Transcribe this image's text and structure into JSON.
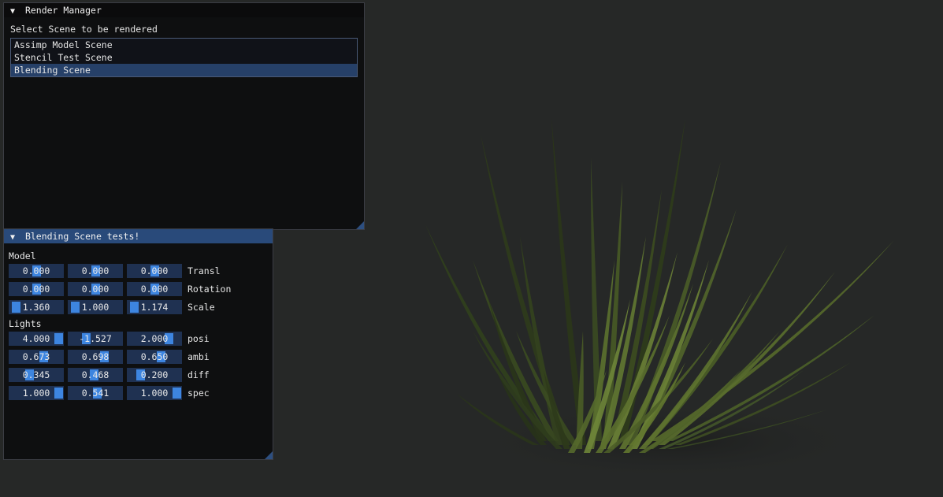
{
  "render_manager": {
    "title": "Render Manager",
    "prompt": "Select Scene to be rendered",
    "scenes": [
      "Assimp Model Scene",
      "Stencil Test Scene",
      "Blending Scene"
    ],
    "selected": "Blending Scene"
  },
  "blending": {
    "title": "Blending Scene tests!",
    "model_header": "Model",
    "lights_header": "Lights",
    "model": [
      {
        "label": "Transl",
        "values": [
          "0.000",
          "0.000",
          "0.000"
        ],
        "grab": [
          0.5,
          0.5,
          0.5
        ]
      },
      {
        "label": "Rotation",
        "values": [
          "0.000",
          "0.000",
          "0.000"
        ],
        "grab": [
          0.5,
          0.5,
          0.5
        ]
      },
      {
        "label": "Scale",
        "values": [
          "1.360",
          "1.000",
          "1.174"
        ],
        "grab": [
          0.05,
          0.05,
          0.05
        ]
      }
    ],
    "lights": [
      {
        "label": "posi",
        "values": [
          "4.000",
          "-1.527",
          "2.000"
        ],
        "grab": [
          1.0,
          0.3,
          0.83
        ]
      },
      {
        "label": "ambi",
        "values": [
          "0.673",
          "0.698",
          "0.650"
        ],
        "grab": [
          0.67,
          0.7,
          0.65
        ]
      },
      {
        "label": "diff",
        "values": [
          "0.345",
          "0.468",
          "0.200"
        ],
        "grab": [
          0.35,
          0.47,
          0.2
        ]
      },
      {
        "label": "spec",
        "values": [
          "1.000",
          "0.541",
          "1.000"
        ],
        "grab": [
          1.0,
          0.54,
          1.0
        ]
      }
    ]
  },
  "scene_object": "grass-plant"
}
